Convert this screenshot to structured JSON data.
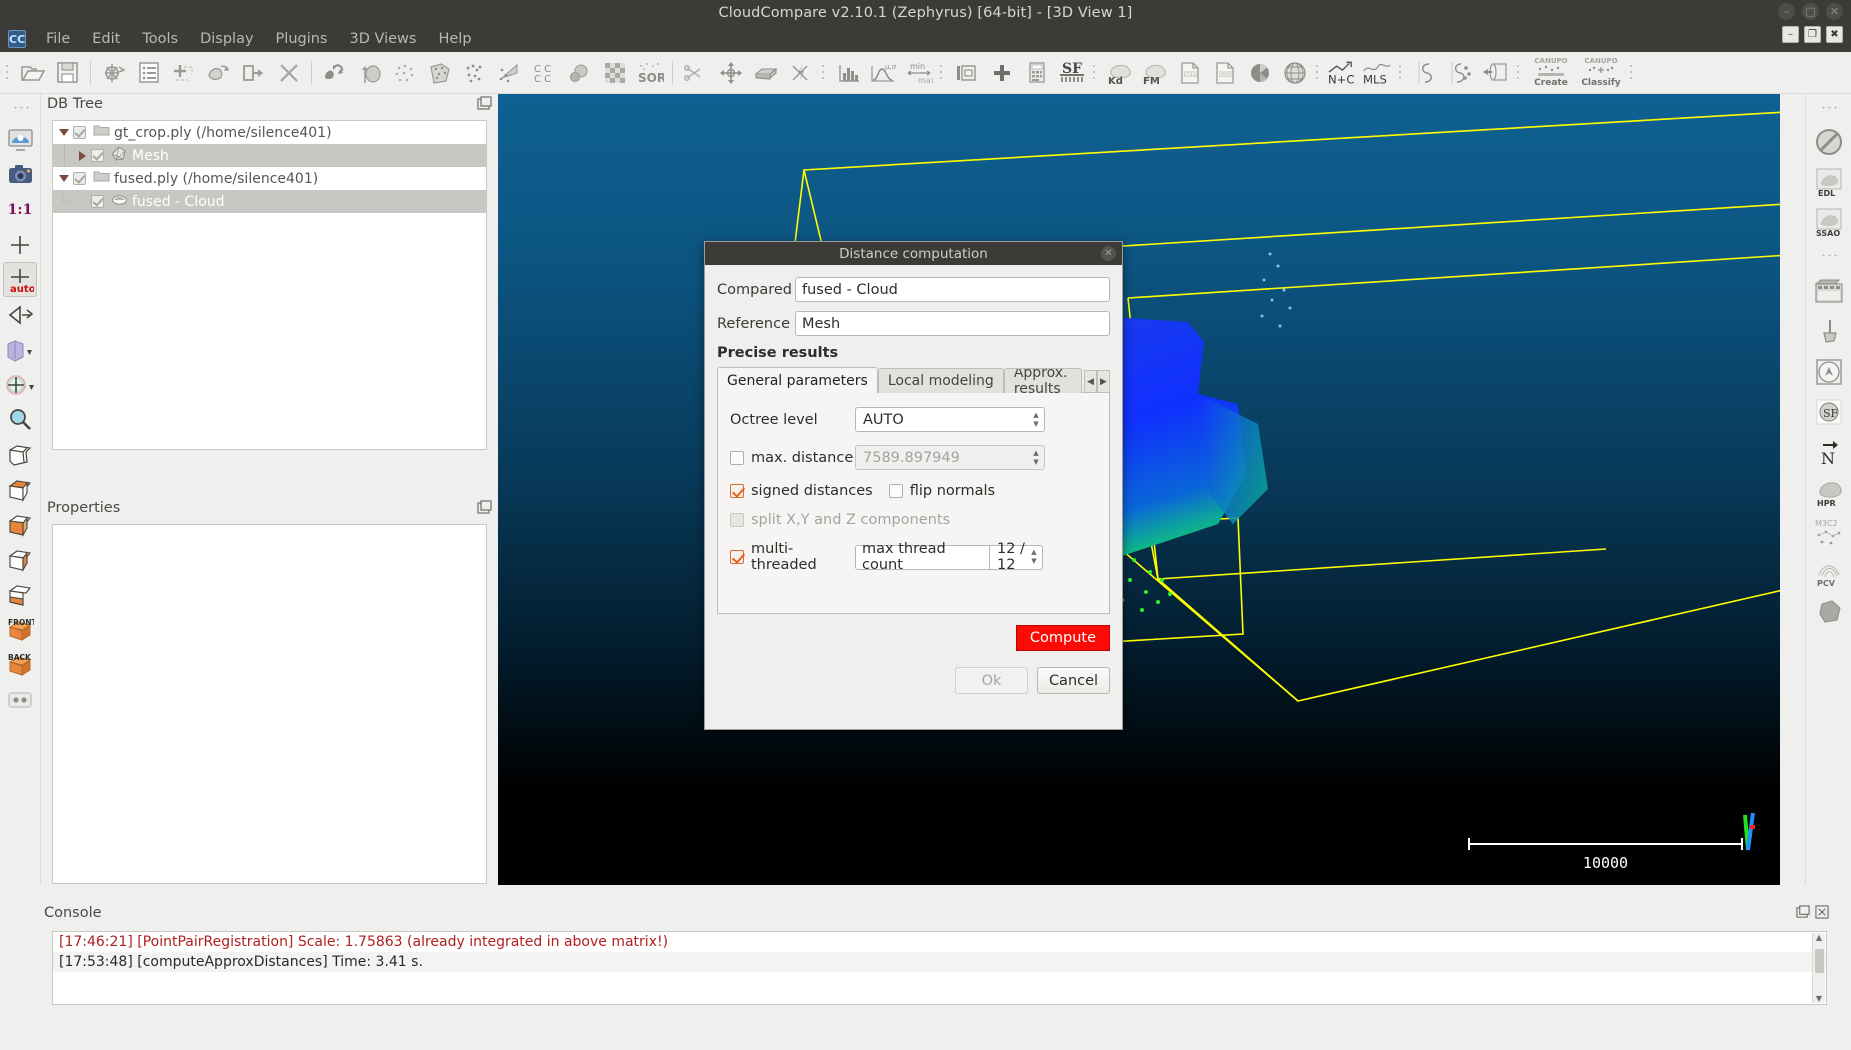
{
  "window": {
    "title": "CloudCompare v2.10.1 (Zephyrus) [64-bit] - [3D View 1]",
    "minimize": "–",
    "maximize": "□",
    "close": "✕",
    "inner_minimize": "–",
    "inner_restore": "❐",
    "inner_close": "✖"
  },
  "menu": {
    "logo": "CC",
    "items": [
      {
        "label": "File"
      },
      {
        "label": "Edit"
      },
      {
        "label": "Tools"
      },
      {
        "label": "Display"
      },
      {
        "label": "Plugins"
      },
      {
        "label": "3D Views"
      },
      {
        "label": "Help"
      }
    ]
  },
  "toolbar": {
    "icons": [
      {
        "name": "open-file-icon"
      },
      {
        "name": "save-icon"
      },
      {
        "name": "clone-icon"
      },
      {
        "name": "properties-list-icon"
      },
      {
        "name": "merge-icon"
      },
      {
        "name": "subsample-icon"
      },
      {
        "name": "delete-entity-icon"
      },
      {
        "name": "close-cross-icon"
      },
      {
        "name": "segment-icon"
      },
      {
        "name": "normals-icon"
      },
      {
        "name": "sample-points-icon"
      },
      {
        "name": "mesh-icon"
      },
      {
        "name": "cloud-cloud-dist-icon"
      },
      {
        "name": "cloud-mesh-dist-icon"
      },
      {
        "name": "cc-label-icon"
      },
      {
        "name": "roughness-icon"
      },
      {
        "name": "checkerboard-icon"
      },
      {
        "name": "sor-filter-icon"
      },
      {
        "name": "scissors-icon"
      },
      {
        "name": "translate-rotate-icon"
      },
      {
        "name": "box-crop-icon"
      },
      {
        "name": "lightning-icon"
      },
      {
        "name": "histogram-icon"
      },
      {
        "name": "gaussian-stats-icon"
      },
      {
        "name": "minmax-icon"
      },
      {
        "name": "trash-sf-icon"
      },
      {
        "name": "plus-icon"
      },
      {
        "name": "calculator-icon"
      },
      {
        "name": "sf-scalar-field-icon"
      },
      {
        "name": "kd-tree-icon"
      },
      {
        "name": "fm-icon"
      },
      {
        "name": "shp-export-icon"
      },
      {
        "name": "csv-export-icon"
      },
      {
        "name": "pie-icon"
      },
      {
        "name": "globe-icon"
      },
      {
        "name": "n-plus-c-icon"
      },
      {
        "name": "mls-icon"
      },
      {
        "name": "curve-s-icon"
      },
      {
        "name": "curve-points-icon"
      },
      {
        "name": "unroll-icon"
      },
      {
        "name": "canupo-create-icon",
        "label": "Create",
        "sub": "CANUPO"
      },
      {
        "name": "canupo-classify-icon",
        "label": "Classify",
        "sub": "CANUPO"
      }
    ],
    "sf_label": "SF",
    "kd_label": "Kd",
    "fm_label": "FM",
    "nc_label": "N+C",
    "mls_label": "MLS",
    "shp_label": "SHP",
    "csv_label": "CSV",
    "minmax_min": "min",
    "minmax_max": "max",
    "sigma_label": "μ,σ"
  },
  "left_toolbar": {
    "icons": [
      {
        "name": "full-screen-display-icon"
      },
      {
        "name": "camera-snapshot-icon"
      },
      {
        "name": "zoom-one-to-one-icon",
        "label": "1:1"
      },
      {
        "name": "set-pivot-icon"
      },
      {
        "name": "auto-pivot-icon",
        "label": "auto",
        "selected": true
      },
      {
        "name": "view-mode-icon"
      },
      {
        "name": "object-color-icon"
      },
      {
        "name": "translate-gizmo-icon"
      },
      {
        "name": "zoom-magnifier-icon"
      },
      {
        "name": "global-zoom-icon"
      },
      {
        "name": "view-top-icon"
      },
      {
        "name": "view-bottom-icon"
      },
      {
        "name": "view-left-icon"
      },
      {
        "name": "view-right-icon"
      },
      {
        "name": "view-front-icon",
        "label": "FRONT"
      },
      {
        "name": "view-back-icon",
        "label": "BACK"
      },
      {
        "name": "stereo-mode-icon"
      }
    ]
  },
  "right_toolbar": {
    "icons": [
      {
        "name": "no-filter-icon"
      },
      {
        "name": "edl-shader-icon",
        "label": "EDL"
      },
      {
        "name": "ssao-shader-icon",
        "label": "SSAO"
      },
      {
        "name": "animation-icon"
      },
      {
        "name": "broom-clean-icon"
      },
      {
        "name": "compass-icon"
      },
      {
        "name": "sf-gradient-icon",
        "label": "SF"
      },
      {
        "name": "normal-direction-icon",
        "label": "N"
      },
      {
        "name": "hpr-icon",
        "label": "HPR"
      },
      {
        "name": "m3c2-icon",
        "label": "M3C2"
      },
      {
        "name": "pcv-icon",
        "label": "PCV"
      },
      {
        "name": "poisson-recon-icon"
      }
    ]
  },
  "db_tree": {
    "title": "DB Tree",
    "float_icon": "float-panel-icon",
    "rows": [
      {
        "label": "gt_crop.ply (/home/silence401)",
        "depth": 0,
        "expander": "down",
        "icon": "folder-icon",
        "checked": true,
        "selected": false
      },
      {
        "label": "Mesh",
        "depth": 1,
        "expander": "right",
        "icon": "mesh-icon",
        "checked": true,
        "selected": true
      },
      {
        "label": "fused.ply (/home/silence401)",
        "depth": 0,
        "expander": "down",
        "icon": "folder-icon",
        "checked": true,
        "selected": false
      },
      {
        "label": "fused - Cloud",
        "depth": 1,
        "expander": "none",
        "icon": "cloud-icon",
        "checked": true,
        "selected": true
      }
    ]
  },
  "properties": {
    "title": "Properties",
    "float_icon": "float-panel-icon"
  },
  "view3d": {
    "scale_value": "10000",
    "crosshair": "+",
    "axis_x_color": "#ff2020",
    "axis_y_color": "#20e020",
    "axis_z_color": "#2090ff",
    "bbox_color": "#ffff00"
  },
  "dialog": {
    "title": "Distance computation",
    "close_icon": "close-icon",
    "compared_label": "Compared",
    "compared_value": "fused - Cloud",
    "reference_label": "Reference",
    "reference_value": "Mesh",
    "section_title": "Precise results",
    "tabs": [
      {
        "label": "General parameters",
        "active": true
      },
      {
        "label": "Local modeling",
        "active": false
      },
      {
        "label": "Approx. results",
        "active": false
      }
    ],
    "tab_prev": "◀",
    "tab_next": "▶",
    "octree_label": "Octree level",
    "octree_value": "AUTO",
    "max_distance_label": "max. distance",
    "max_distance_checked": false,
    "max_distance_value": "7589.897949",
    "signed_distances_label": "signed distances",
    "signed_distances_checked": true,
    "flip_normals_label": "flip normals",
    "flip_normals_checked": false,
    "split_components_label": "split X,Y and Z components",
    "split_components_checked": false,
    "split_components_disabled": true,
    "multi_threaded_label": "multi-threaded",
    "multi_threaded_checked": true,
    "thread_count_label": "max thread count",
    "thread_count_value": "12 / 12",
    "compute_label": "Compute",
    "ok_label": "Ok",
    "ok_disabled": true,
    "cancel_label": "Cancel",
    "spin_up": "▲",
    "spin_down": "▼",
    "compute_color": "#fb0b06"
  },
  "console": {
    "title": "Console",
    "float_icon": "float-panel-icon",
    "close_icon": "close-panel-icon",
    "lines": [
      {
        "text": "[17:46:21] [PointPairRegistration] Scale: 1.75863 (already integrated in above matrix!)",
        "level": "error"
      },
      {
        "text": "[17:53:48] [computeApproxDistances] Time: 3.41 s.",
        "level": "info"
      }
    ],
    "scroll_up": "▲",
    "scroll_down": "▼"
  }
}
